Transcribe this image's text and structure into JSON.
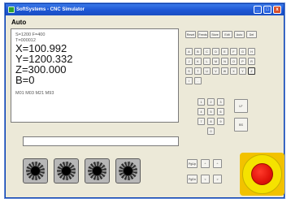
{
  "window": {
    "title": "SoftSystems - CNC Simulator",
    "controls": [
      "_",
      "□",
      "x"
    ]
  },
  "mode": "Auto",
  "display": {
    "status_line": "S=1200 F=400",
    "tool_line": "T=000012",
    "axes": [
      "X=100.992",
      "Y=1200.332",
      "Z=300.000",
      "B=0"
    ],
    "mcodes": "M01 M03 M21 M93"
  },
  "command_input": {
    "value": ""
  },
  "function_keys": [
    "Reset",
    "Feeds",
    "Store",
    "Edit",
    "Auto",
    "Del"
  ],
  "letter_keys": [
    "A",
    "B",
    "C",
    "D",
    "E",
    "F",
    "G",
    "H",
    "J",
    "K",
    "L",
    "M",
    "N",
    "O",
    "P",
    "R",
    "S",
    "T",
    "U",
    "V",
    "W",
    "X",
    "Y",
    "Z",
    "/",
    "."
  ],
  "number_keys": [
    "1",
    "2",
    "3",
    "4",
    "5",
    "6",
    "7",
    "8",
    "9",
    "0"
  ],
  "side_keys": [
    "LF",
    "BS"
  ],
  "nav_keys": {
    "row1": [
      "PgUp",
      "^",
      "^"
    ],
    "row2": [
      "PgDn",
      "<",
      ">"
    ]
  },
  "knobs": [
    "knob-1",
    "knob-2",
    "knob-3",
    "knob-4"
  ],
  "colors": {
    "window_bg": "#ece9d8",
    "titlebar": "#1d56d4",
    "estop_red": "#e0130a",
    "estop_yellow": "#f5e200"
  }
}
